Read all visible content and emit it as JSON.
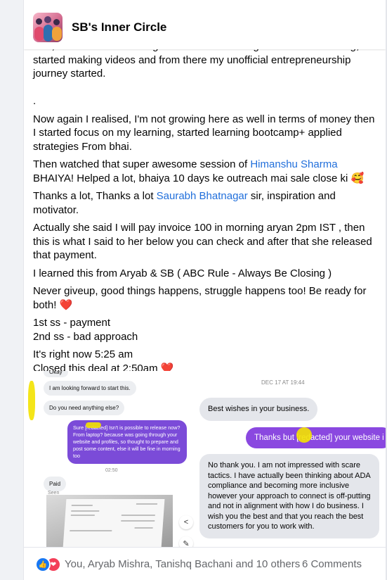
{
  "group": {
    "name": "SB's Inner Circle"
  },
  "post": {
    "paragraphs": [
      {
        "text": "was, because of the change from content writing to affiliate marketing, I started making videos and from there my unofficial entrepreneurship journey started.\n\n."
      },
      {
        "text": "Now again I realised, I'm not growing here as well in terms of money then I started focus on my learning, started learning bootcamp+ applied strategies From bhai."
      },
      {
        "before": "Then watched that super awesome session of ",
        "link": "Himanshu Sharma",
        "after": "\nBHAIYA! Helped a lot, bhaiya 10 days ke outreach mai sale close ki 🥰"
      },
      {
        "before": "Thanks a lot, Thanks a lot ",
        "link": "Saurabh Bhatnagar",
        "after": "  sir, inspiration and motivator."
      },
      {
        "text": "Actually she said I will pay invoice 100  in morning aryan 2pm IST , then this is what I said to her below you can check and after that she released that payment."
      },
      {
        "text": "I learned this from Aryab & SB ( ABC Rule - Always Be Closing )"
      },
      {
        "text": "Never giveup, good things happens, struggle happens too! Be ready for both!  ❤️"
      },
      {
        "text": "1st ss - payment\n2nd ss - bad approach"
      },
      {
        "text": "It's right now 5:25 am\nClosed this deal at 2:50am ❤️"
      }
    ]
  },
  "screenshot_left": {
    "okay": "Okay",
    "looking_forward": "I am looking forward to start this.",
    "need_anything": "Do you need anything else?",
    "sure_message": "Sure [redacted] Isn't is possible to release now? From laptop? because was going through your website and profiles, so thought to prepare and post some content, else it will be fine in morning too",
    "time": "02:50",
    "paid": "Paid",
    "seen": "Seen"
  },
  "screenshot_right": {
    "date": "DEC 17 AT 19:44",
    "best_wishes": "Best wishes in your business.",
    "thanks_but": "Thanks but [redacted] your website i",
    "no_thank_you": "No thank you.  I am not impressed with scare tactics.  I have actually been thinking about ADA compliance and becoming more inclusive however your approach to connect is off-putting and not in alignment with how I do business.  I wish you the best and that you reach the best customers for you to work with."
  },
  "reactions": {
    "names": "You, Aryab Mishra, Tanishq Bachani and 10 others",
    "comments": "6 Comments"
  }
}
